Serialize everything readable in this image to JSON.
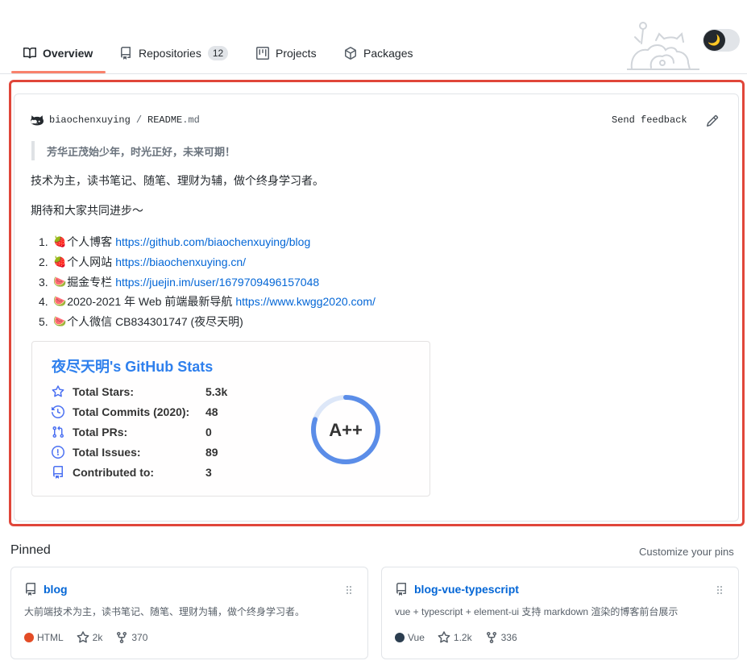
{
  "tabs": [
    {
      "label": "Overview",
      "icon": "book-icon",
      "active": true
    },
    {
      "label": "Repositories",
      "icon": "repo-icon",
      "count": "12"
    },
    {
      "label": "Projects",
      "icon": "project-icon"
    },
    {
      "label": "Packages",
      "icon": "package-icon"
    }
  ],
  "theme_toggle": {
    "icon": "moon-icon",
    "knob": "🌙"
  },
  "readme": {
    "user": "biaochenxuying",
    "separator": "/",
    "file": "README",
    "ext": ".md",
    "send_feedback": "Send feedback",
    "quote": "芳华正茂始少年，时光正好，未来可期！",
    "intro": "技术为主，读书笔记、随笔、理财为辅，做个终身学习者。",
    "hope": "期待和大家共同进步～",
    "list": [
      {
        "num": "1.",
        "emoji": "🍓",
        "text": "个人博客",
        "link": "https://github.com/biaochenxuying/blog"
      },
      {
        "num": "2.",
        "emoji": "🍓",
        "text": "个人网站",
        "link": "https://biaochenxuying.cn/"
      },
      {
        "num": "3.",
        "emoji": "🍉",
        "text": "掘金专栏",
        "link": "https://juejin.im/user/1679709496157048"
      },
      {
        "num": "4.",
        "emoji": "🍉",
        "text": "2020-2021 年 Web 前端最新导航",
        "link": "https://www.kwgg2020.com/"
      },
      {
        "num": "5.",
        "emoji": "🍉",
        "text": "个人微信 CB834301747 (夜尽天明)",
        "link": ""
      }
    ]
  },
  "stats": {
    "title": "夜尽天明's GitHub Stats",
    "rows": [
      {
        "label": "Total Stars:",
        "value": "5.3k",
        "icon": "star-icon"
      },
      {
        "label": "Total Commits (2020):",
        "value": "48",
        "icon": "history-icon"
      },
      {
        "label": "Total PRs:",
        "value": "0",
        "icon": "pull-request-icon"
      },
      {
        "label": "Total Issues:",
        "value": "89",
        "icon": "issue-icon"
      },
      {
        "label": "Contributed to:",
        "value": "3",
        "icon": "repo-icon"
      }
    ],
    "grade": "A++",
    "grade_progress": 0.8,
    "accent": "#2f80ed"
  },
  "pinned": {
    "title": "Pinned",
    "customize": "Customize your pins",
    "cards": [
      {
        "name": "blog",
        "desc": "大前端技术为主，读书笔记、随笔、理财为辅，做个终身学习者。",
        "lang": "HTML",
        "lang_color": "#e34c26",
        "stars": "2k",
        "forks": "370"
      },
      {
        "name": "blog-vue-typescript",
        "desc": "vue + typescript + element-ui 支持 markdown 渲染的博客前台展示",
        "lang": "Vue",
        "lang_color": "#2c3e50",
        "stars": "1.2k",
        "forks": "336"
      }
    ]
  }
}
